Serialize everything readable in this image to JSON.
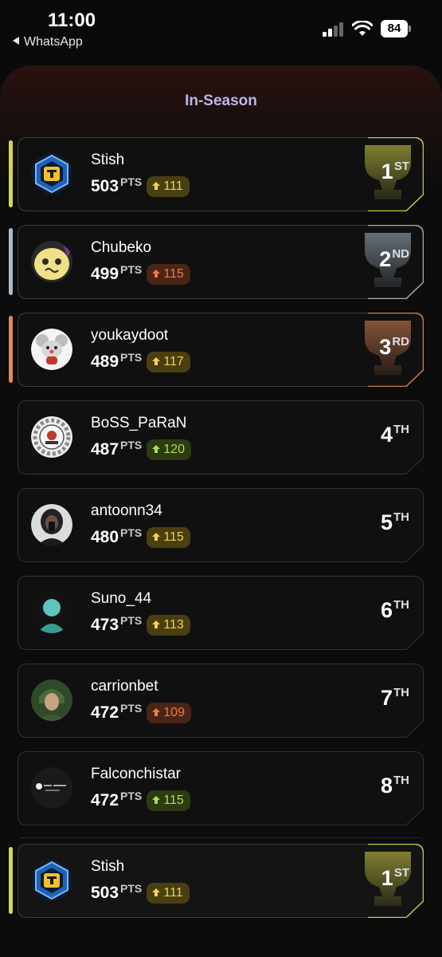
{
  "status_bar": {
    "time": "11:00",
    "back_app": "WhatsApp",
    "battery": "84"
  },
  "title": "In-Season",
  "pts_unit": "PTS",
  "entries": [
    {
      "name": "Stish",
      "points": "503",
      "delta": "111",
      "delta_color": "yellow",
      "rank": "1",
      "suffix": "ST",
      "avatar": "hex-badge-icon",
      "accent": "#d8d64a"
    },
    {
      "name": "Chubeko",
      "points": "499",
      "delta": "115",
      "delta_color": "orange",
      "rank": "2",
      "suffix": "ND",
      "avatar": "yellow-creature-icon",
      "accent": "#a9bccb"
    },
    {
      "name": "youkaydoot",
      "points": "489",
      "delta": "117",
      "delta_color": "yellow",
      "rank": "3",
      "suffix": "RD",
      "avatar": "mouse-mascot-icon",
      "accent": "#e08a55"
    },
    {
      "name": "BoSS_PaRaN",
      "points": "487",
      "delta": "120",
      "delta_color": "green",
      "rank": "4",
      "suffix": "TH",
      "avatar": "gear-logo-icon"
    },
    {
      "name": "antoonn34",
      "points": "480",
      "delta": "115",
      "delta_color": "yellow",
      "rank": "5",
      "suffix": "TH",
      "avatar": "person-photo-icon"
    },
    {
      "name": "Suno_44",
      "points": "473",
      "delta": "113",
      "delta_color": "yellow",
      "rank": "6",
      "suffix": "TH",
      "avatar": "default-avatar-icon"
    },
    {
      "name": "carrionbet",
      "points": "472",
      "delta": "109",
      "delta_color": "orange",
      "rank": "7",
      "suffix": "TH",
      "avatar": "hooded-person-icon"
    },
    {
      "name": "Falconchistar",
      "points": "472",
      "delta": "115",
      "delta_color": "green",
      "rank": "8",
      "suffix": "TH",
      "avatar": "football-logo-icon"
    }
  ],
  "current_user": {
    "name": "Stish",
    "points": "503",
    "delta": "111",
    "delta_color": "yellow",
    "rank": "1",
    "suffix": "ST",
    "avatar": "hex-badge-icon",
    "accent": "#d8d64a"
  },
  "colors": {
    "gold": "#d8d64a",
    "silver": "#a9bccb",
    "bronze": "#e08a55",
    "title": "#b9b7ec"
  }
}
